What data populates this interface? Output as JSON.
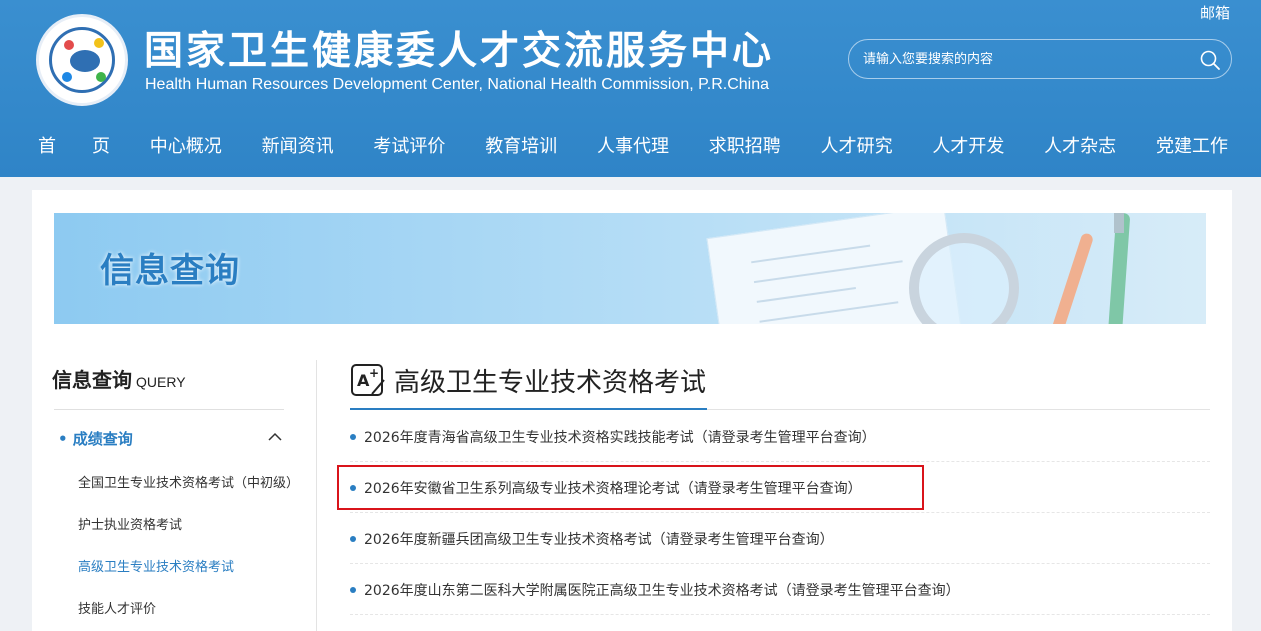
{
  "header": {
    "title_cn": "国家卫生健康委人才交流服务中心",
    "title_en": "Health Human Resources Development Center, National Health Commission, P.R.China",
    "mail_link": "邮箱",
    "search": {
      "placeholder": "请输入您要搜索的内容"
    },
    "nav": [
      {
        "label": "首　　页"
      },
      {
        "label": "中心概况"
      },
      {
        "label": "新闻资讯"
      },
      {
        "label": "考试评价"
      },
      {
        "label": "教育培训"
      },
      {
        "label": "人事代理"
      },
      {
        "label": "求职招聘"
      },
      {
        "label": "人才研究"
      },
      {
        "label": "人才开发"
      },
      {
        "label": "人才杂志"
      },
      {
        "label": "党建工作"
      }
    ]
  },
  "banner": {
    "title": "信息查询"
  },
  "sidebar": {
    "title": "信息查询",
    "title_en": "QUERY",
    "active_group": "• 成绩查询",
    "items": [
      {
        "label": "全国卫生专业技术资格考试（中初级）"
      },
      {
        "label": "护士执业资格考试"
      },
      {
        "label": "高级卫生专业技术资格考试"
      },
      {
        "label": "技能人才评价"
      }
    ]
  },
  "section": {
    "title": "高级卫生专业技术资格考试",
    "items": [
      {
        "label": "2026年度青海省高级卫生专业技术资格实践技能考试（请登录考生管理平台查询）"
      },
      {
        "label": "2026年安徽省卫生系列高级专业技术资格理论考试（请登录考生管理平台查询）"
      },
      {
        "label": "2026年度新疆兵团高级卫生专业技术资格考试（请登录考生管理平台查询）"
      },
      {
        "label": "2026年度山东第二医科大学附属医院正高级卫生专业技术资格考试（请登录考生管理平台查询）"
      }
    ]
  },
  "colors": {
    "header_blue": "#2f86c9",
    "accent_blue": "#2a7ec2",
    "highlight_red": "#d9141b"
  }
}
